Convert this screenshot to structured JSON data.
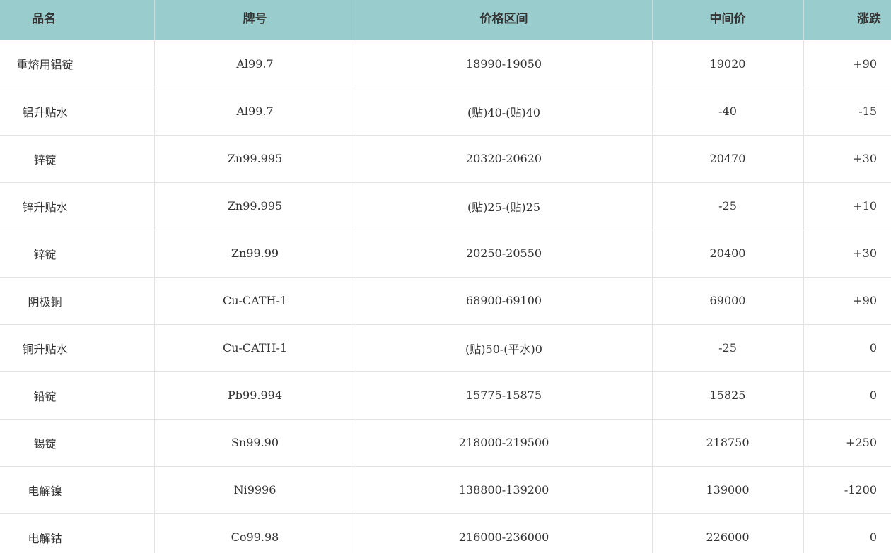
{
  "table": {
    "headers": [
      "品名",
      "牌号",
      "价格区间",
      "中间价",
      "涨跌"
    ],
    "rows": [
      [
        "重熔用铝锭",
        "Al99.7",
        "18990-19050",
        "19020",
        "+90"
      ],
      [
        "铝升贴水",
        "Al99.7",
        "(贴)40-(贴)40",
        "-40",
        "-15"
      ],
      [
        "锌锭",
        "Zn99.995",
        "20320-20620",
        "20470",
        "+30"
      ],
      [
        "锌升贴水",
        "Zn99.995",
        "(贴)25-(贴)25",
        "-25",
        "+10"
      ],
      [
        "锌锭",
        "Zn99.99",
        "20250-20550",
        "20400",
        "+30"
      ],
      [
        "阴极铜",
        "Cu-CATH-1",
        "68900-69100",
        "69000",
        "+90"
      ],
      [
        "铜升贴水",
        "Cu-CATH-1",
        "(贴)50-(平水)0",
        "-25",
        "0"
      ],
      [
        "铅锭",
        "Pb99.994",
        "15775-15875",
        "15825",
        "0"
      ],
      [
        "锡锭",
        "Sn99.90",
        "218000-219500",
        "218750",
        "+250"
      ],
      [
        "电解镍",
        "Ni9996",
        "138800-139200",
        "139000",
        "-1200"
      ],
      [
        "电解钴",
        "Co99.98",
        "216000-236000",
        "226000",
        "0"
      ]
    ]
  },
  "colors": {
    "header_bg": "#99cccc",
    "text": "#333333",
    "grid": "#e3e3e3"
  }
}
